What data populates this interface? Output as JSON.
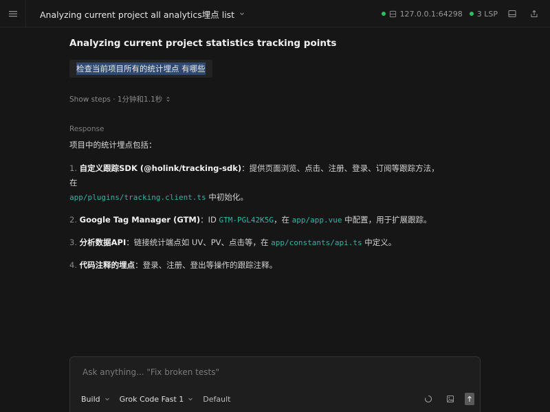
{
  "header": {
    "title": "Analyzing current project all analytics埋点 list",
    "server": "127.0.0.1:64298",
    "lsp": "3 LSP",
    "status_color": "#22c55e"
  },
  "conversation": {
    "heading": "Analyzing current project statistics tracking points",
    "user_message": "检查当前项目所有的统计埋点 有哪些",
    "steps_label": "Show steps · 1分钟和1.1秒",
    "response_label": "Response",
    "response_intro": "项目中的统计埋点包括：",
    "items": [
      {
        "num": "1.",
        "title": "自定义跟踪SDK (@holink/tracking-sdk)",
        "text_a": "：提供页面浏览、点击、注册、登录、订阅等跟踪方法，在",
        "code_a": "app/plugins/tracking.client.ts",
        "text_b": " 中初始化。"
      },
      {
        "num": "2.",
        "title": "Google Tag Manager (GTM)",
        "text_a": "：ID ",
        "code_a": "GTM-PGL42K5G",
        "text_b": "，在 ",
        "code_b": "app/app.vue",
        "text_c": " 中配置，用于扩展跟踪。"
      },
      {
        "num": "3.",
        "title": "分析数据API",
        "text_a": "：链接统计端点如 UV、PV、点击等，在 ",
        "code_a": "app/constants/api.ts",
        "text_b": " 中定义。"
      },
      {
        "num": "4.",
        "title": "代码注释的埋点",
        "text_a": "：登录、注册、登出等操作的跟踪注释。"
      }
    ]
  },
  "composer": {
    "placeholder": "Ask anything... \"Fix broken tests\"",
    "value": "",
    "mode": "Build",
    "model": "Grok Code Fast 1",
    "variant": "Default"
  },
  "colors": {
    "accent_code": "#2fb5a6",
    "selection": "#2f4a72",
    "background": "#161616"
  }
}
